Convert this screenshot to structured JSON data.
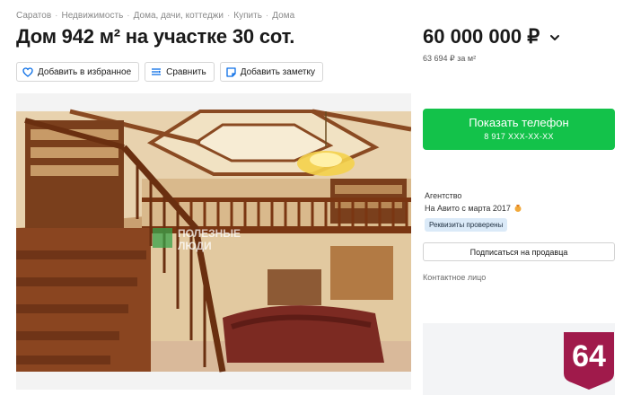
{
  "breadcrumbs": [
    "Саратов",
    "Недвижимость",
    "Дома, дачи, коттеджи",
    "Купить",
    "Дома"
  ],
  "breadcrumb_separator": "·",
  "title": "Дом 942 м² на участке 30 сот.",
  "price": {
    "value": "60 000 000 ₽",
    "per_unit": "63 694 ₽ за м²",
    "chevron_icon": "chevron-down-icon"
  },
  "actions": {
    "favorite_label": "Добавить в избранное",
    "favorite_icon": "heart-icon",
    "compare_label": "Сравнить",
    "compare_icon": "compare-icon",
    "note_label": "Добавить заметку",
    "note_icon": "note-icon"
  },
  "photo": {
    "watermark": "ПОЛЕЗНЫЕ ЛЮДИ"
  },
  "seller": {
    "phone_button_label": "Показать телефон",
    "phone_number": "8 917 XXX-XX-XX",
    "type": "Агентство",
    "since": "На Авито с марта 2017",
    "verified_badge": "Реквизиты проверены",
    "subscribe_label": "Подписаться на продавца",
    "contact_label": "Контактное лицо"
  },
  "overlay_badge": {
    "text": "64",
    "color": "#a01a4b"
  },
  "colors": {
    "accent_green": "#13c24a",
    "link_blue": "#0a6ee6",
    "badge_blue_bg": "#dbeaf8"
  }
}
